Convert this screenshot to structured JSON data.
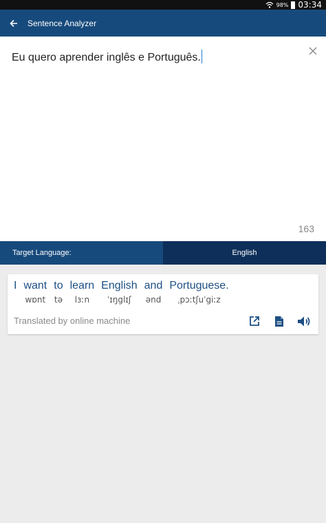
{
  "status_bar": {
    "battery": "98%",
    "time": "03:34"
  },
  "app_bar": {
    "title": "Sentence Analyzer"
  },
  "editor": {
    "text": "Eu quero aprender inglês e Português.",
    "char_count": "163"
  },
  "language_bar": {
    "label": "Target Language:",
    "value": "English"
  },
  "translation": {
    "words": [
      {
        "text": "I",
        "ipa": ""
      },
      {
        "text": "want",
        "ipa": "wɒnt"
      },
      {
        "text": "to",
        "ipa": "tə"
      },
      {
        "text": "learn",
        "ipa": "lɜːn"
      },
      {
        "text": "English",
        "ipa": "ˈɪŋglɪʃ"
      },
      {
        "text": "and",
        "ipa": "ənd"
      },
      {
        "text": "Portuguese.",
        "ipa": "ˌpɔːtʃuˈgiːz"
      }
    ],
    "credit": "Translated by online machine"
  },
  "colors": {
    "primary": "#174a7c",
    "primary_dark": "#0d2f5a",
    "word": "#1d4f83"
  }
}
